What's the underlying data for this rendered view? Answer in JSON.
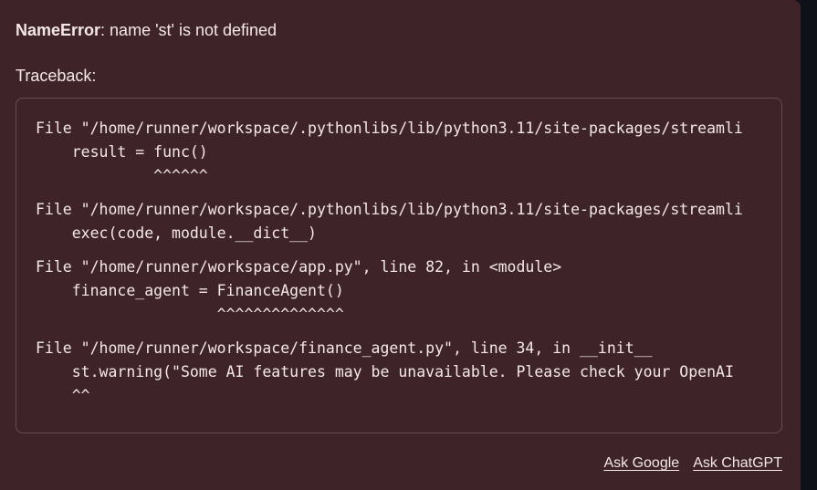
{
  "error": {
    "type": "NameError",
    "message": ": name 'st' is not defined"
  },
  "traceback": {
    "label": "Traceback:",
    "frames": [
      {
        "file_line": "File \"/home/runner/workspace/.pythonlibs/lib/python3.11/site-packages/streamli",
        "code_line": "    result = func()",
        "marker_line": "             ^^^^^^"
      },
      {
        "file_line": "File \"/home/runner/workspace/.pythonlibs/lib/python3.11/site-packages/streamli",
        "code_line": "    exec(code, module.__dict__)",
        "marker_line": null
      },
      {
        "file_line": "File \"/home/runner/workspace/app.py\", line 82, in <module>",
        "code_line": "    finance_agent = FinanceAgent()",
        "marker_line": "                    ^^^^^^^^^^^^^^"
      },
      {
        "file_line": "File \"/home/runner/workspace/finance_agent.py\", line 34, in __init__",
        "code_line": "    st.warning(\"Some AI features may be unavailable. Please check your OpenAI",
        "marker_line": "    ^^"
      }
    ]
  },
  "actions": {
    "ask_google": "Ask Google",
    "ask_chatgpt": "Ask ChatGPT"
  }
}
